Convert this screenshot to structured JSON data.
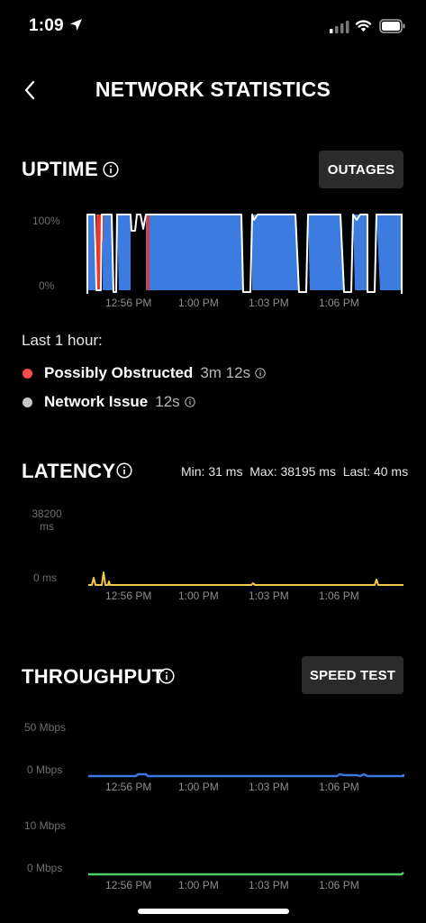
{
  "status_bar": {
    "time": "1:09"
  },
  "header": {
    "title": "NETWORK STATISTICS"
  },
  "uptime": {
    "title": "UPTIME",
    "outages_label": "OUTAGES",
    "y_labels": [
      "100%",
      "0%"
    ],
    "x_ticks": [
      "12:56 PM",
      "1:00 PM",
      "1:03 PM",
      "1:06 PM"
    ],
    "period_label": "Last 1 hour:",
    "items": [
      {
        "name": "Possibly Obstructed",
        "value": "3m 12s",
        "color": "#ff4d4d"
      },
      {
        "name": "Network Issue",
        "value": "12s",
        "color": "#c7c7c7"
      }
    ],
    "colors": {
      "fill": "#3c7be0",
      "obstructed": "#e8372f",
      "issue": "#ffffff"
    }
  },
  "latency": {
    "title": "LATENCY",
    "stats": "Min: 31 ms  Max: 38195 ms  Last: 40 ms",
    "y_top": "38200",
    "y_top_unit": "ms",
    "y_bottom": "0 ms",
    "x_ticks": [
      "12:56 PM",
      "1:00 PM",
      "1:03 PM",
      "1:06 PM"
    ],
    "color": "#f2c94c"
  },
  "throughput": {
    "title": "THROUGHPUT",
    "speed_test_label": "SPEED TEST",
    "download": {
      "y_top": "50 Mbps",
      "y_bottom": "0 Mbps",
      "x_ticks": [
        "12:56 PM",
        "1:00 PM",
        "1:03 PM",
        "1:06 PM"
      ],
      "color": "#3a78e0"
    },
    "upload": {
      "y_top": "10 Mbps",
      "y_bottom": "0 Mbps",
      "x_ticks": [
        "12:56 PM",
        "1:00 PM",
        "1:03 PM",
        "1:06 PM"
      ],
      "color": "#4cd06a"
    }
  }
}
